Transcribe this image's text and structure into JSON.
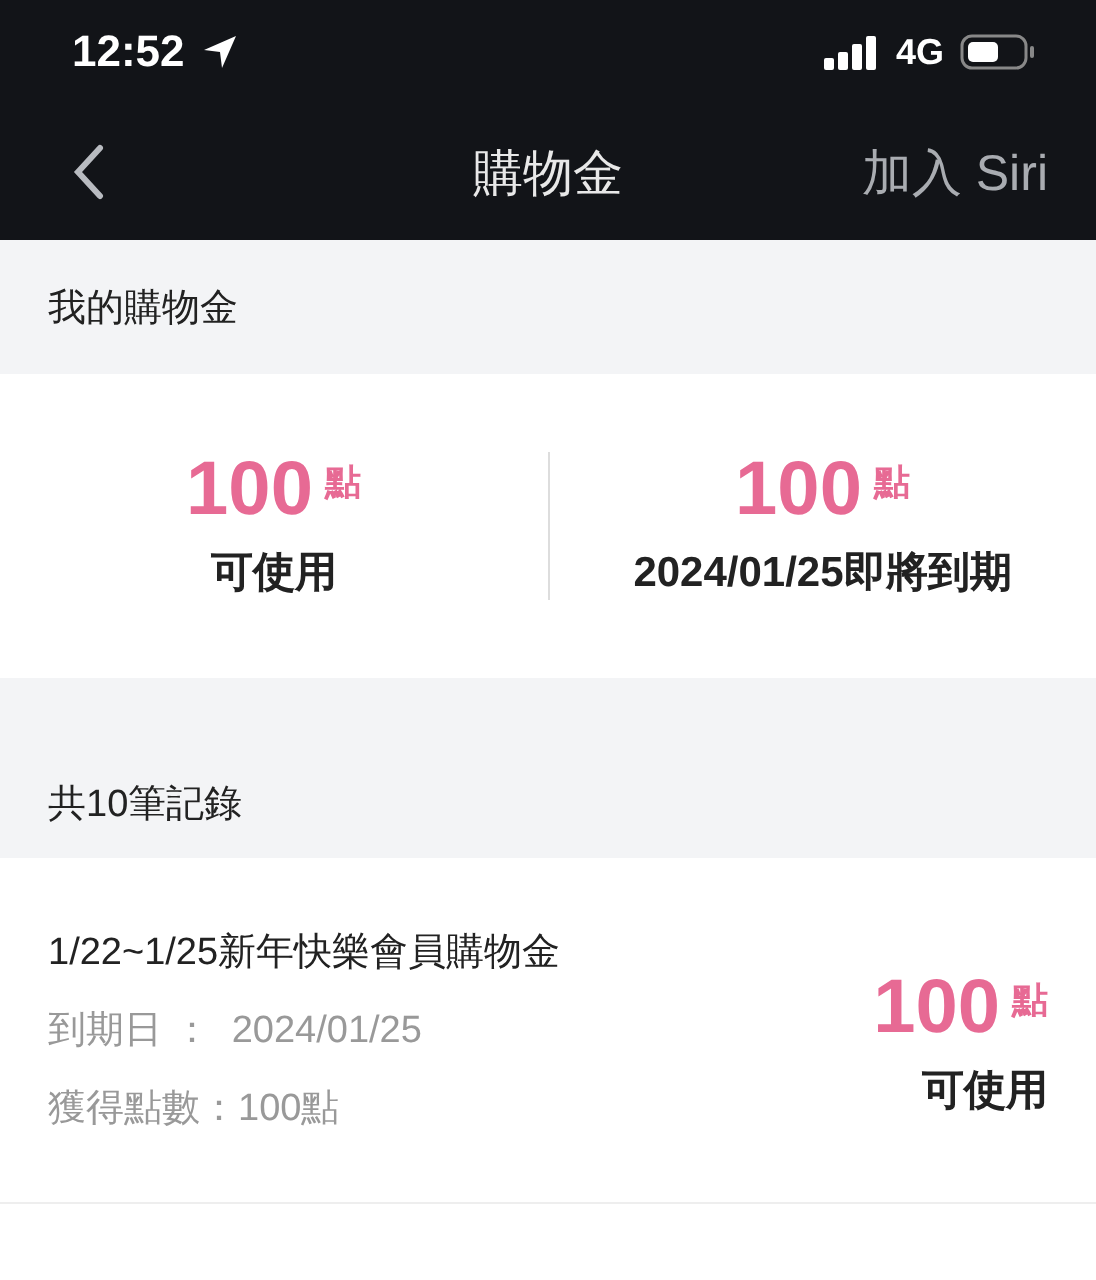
{
  "status_bar": {
    "time": "12:52",
    "network": "4G"
  },
  "nav": {
    "title": "購物金",
    "action": "加入 Siri"
  },
  "summary": {
    "heading": "我的購物金",
    "cells": [
      {
        "points": "100",
        "unit": "點",
        "label": "可使用"
      },
      {
        "points": "100",
        "unit": "點",
        "label": "2024/01/25即將到期"
      }
    ]
  },
  "records": {
    "heading": "共10筆記錄",
    "items": [
      {
        "title": "1/22~1/25新年快樂會員購物金",
        "expiry_label": "到期日 ：",
        "expiry": "2024/01/25",
        "earned_label": "獲得點數：",
        "earned": "100點",
        "points": "100",
        "unit": "點",
        "status": "可使用"
      }
    ]
  }
}
